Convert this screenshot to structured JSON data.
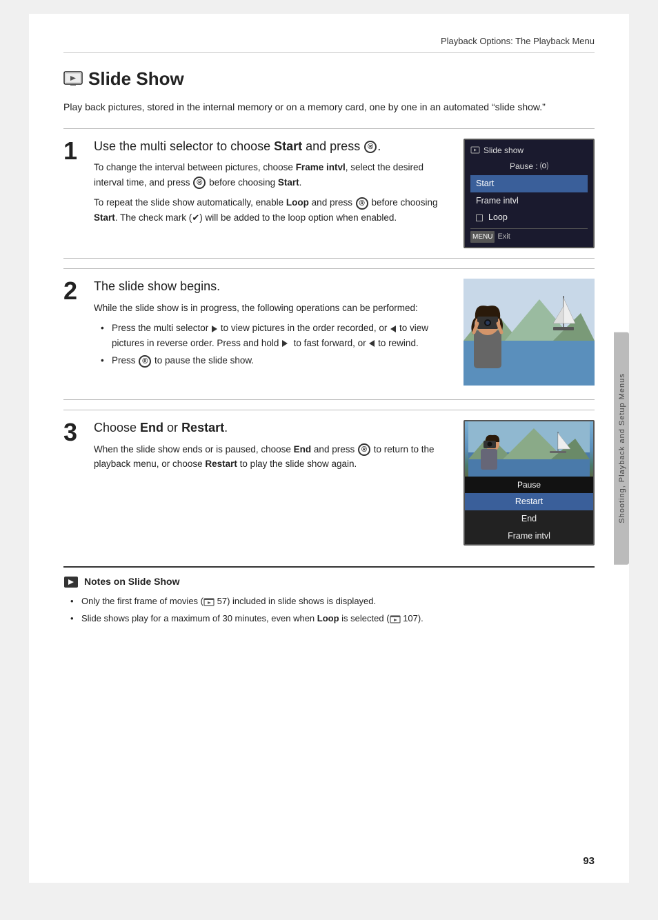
{
  "page": {
    "header": "Playback Options: The Playback Menu",
    "page_number": "93",
    "side_tab": "Shooting, Playback and Setup Menus"
  },
  "section": {
    "title": "Slide Show",
    "intro": "Play back pictures, stored in the internal memory or on a memory card, one by one in an automated “slide show.”"
  },
  "steps": [
    {
      "num": "1",
      "heading": "Use the multi selector to choose Start and press ⒪.",
      "body1": "To change the interval between pictures, choose Frame intvl, select the desired interval time, and press ⒪ before choosing Start.",
      "body2": "To repeat the slide show automatically, enable Loop and press ⒪ before choosing Start. The check mark (✓) will be added to the loop option when enabled.",
      "ui": {
        "title": "Slide show",
        "pause": "Pause : ⒪",
        "items": [
          "Start",
          "Frame intvl",
          "□  Loop"
        ],
        "footer": "MENU Exit"
      }
    },
    {
      "num": "2",
      "heading": "The slide show begins.",
      "body": "While the slide show is in progress, the following operations can be performed:",
      "bullets": [
        "Press the multi selector ▶ to view pictures in the order recorded, or ◄ to view pictures in reverse order. Press and hold ▶  to fast forward, or ◄ to rewind.",
        "Press ⒪ to pause the slide show."
      ]
    },
    {
      "num": "3",
      "heading_prefix": "Choose ",
      "heading_bold1": "End",
      "heading_middle": " or ",
      "heading_bold2": "Restart",
      "heading_suffix": ".",
      "body_prefix": "When the slide show ends or is paused, choose ",
      "body_bold1": "End",
      "body_middle": " and press ⒪ to return to the playback menu, or choose ",
      "body_bold2": "Restart",
      "body_suffix": " to play the slide show again.",
      "ui2": {
        "items": [
          "Pause",
          "Restart",
          "End",
          "Frame intvl"
        ]
      }
    }
  ],
  "notes": {
    "title": "Notes on Slide Show",
    "items": [
      "Only the first frame of movies (⬡ 57) included in slide shows is displayed.",
      "Slide shows play for a maximum of 30 minutes, even when Loop is selected (⬡ 107)."
    ]
  }
}
